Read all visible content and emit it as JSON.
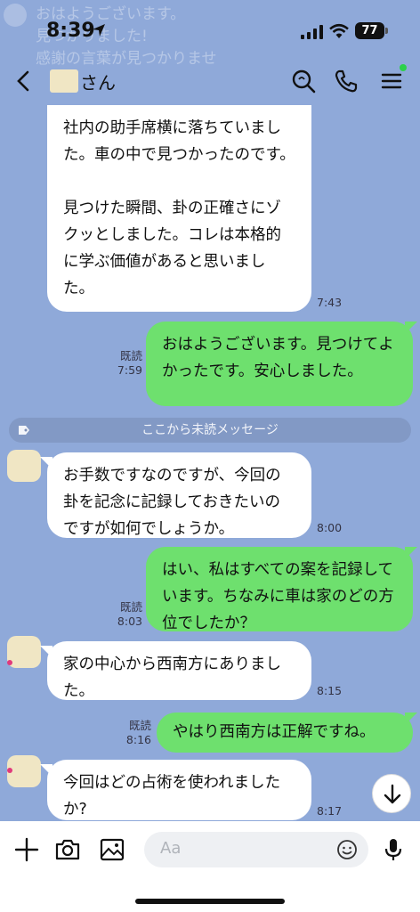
{
  "notification": {
    "lines": [
      "おはようございます。",
      "見つかりました!",
      "感謝の言葉が見つかりませ"
    ]
  },
  "status_bar": {
    "time": "8:39",
    "battery": "77"
  },
  "header": {
    "contact_suffix": "さん"
  },
  "messages": [
    {
      "side": "in",
      "text": "社内の助手席横に落ちていました。車の中で見つかったのです。\n\n見つけた瞬間、卦の正確さにゾクッとしました。コレは本格的に学ぶ価値があると思いました。",
      "time": "7:43"
    },
    {
      "side": "out",
      "text": "おはようございます。見つけてよかったです。安心しました。",
      "read": "既読",
      "time": "7:59"
    },
    {
      "side": "in",
      "text": "お手数ですなのですが、今回の卦を記念に記録しておきたいのですが如何でしょうか。",
      "time": "8:00"
    },
    {
      "side": "out",
      "text": "はい、私はすべての案を記録しています。ちなみに車は家のどの方位でしたか？",
      "read": "既読",
      "time": "8:03"
    },
    {
      "side": "in",
      "text": "家の中心から西南方にありました。",
      "time": "8:15"
    },
    {
      "side": "out",
      "text": "やはり西南方は正解ですね。",
      "read": "既読",
      "time": "8:16"
    },
    {
      "side": "in",
      "text": "今回はどの占術を使われましたか?",
      "time": "8:17"
    }
  ],
  "unread_divider": "ここから未読メッセージ",
  "composer": {
    "placeholder": "Aa"
  },
  "colors": {
    "background": "#8fa9d9",
    "outgoing": "#6ee06e",
    "incoming": "#ffffff"
  }
}
